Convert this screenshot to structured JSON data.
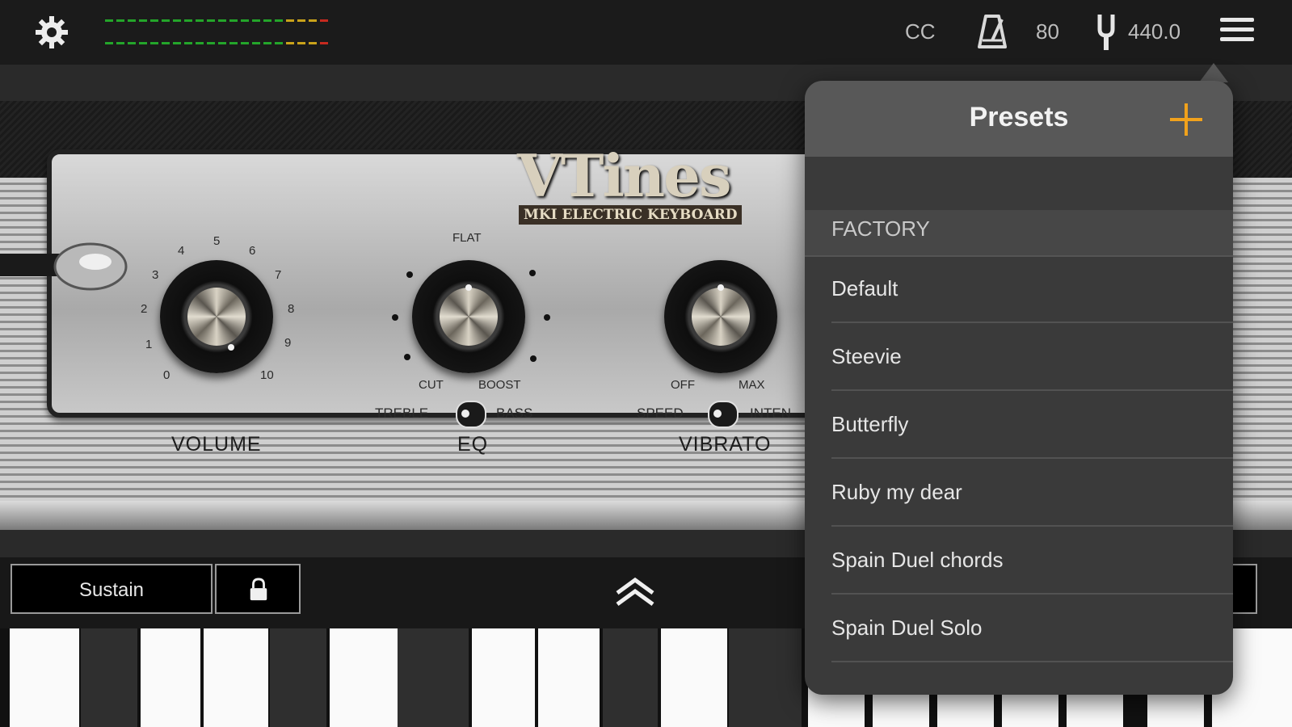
{
  "topbar": {
    "cc_label": "CC",
    "tempo_value": "80",
    "tuning_value": "440.0",
    "icons": [
      "gear-icon",
      "metronome-icon",
      "tuning-fork-icon",
      "menu-icon"
    ]
  },
  "instrument": {
    "logo_title": "VTines",
    "logo_subtitle": "MKI ELECTRIC KEYBOARD",
    "volume": {
      "label": "VOLUME",
      "scale": [
        "0",
        "1",
        "2",
        "3",
        "4",
        "5",
        "6",
        "7",
        "8",
        "9",
        "10"
      ]
    },
    "eq": {
      "label": "EQ",
      "flat": "FLAT",
      "cut": "CUT",
      "boost": "BOOST",
      "left_mode": "TREBLE",
      "right_mode": "BASS"
    },
    "vibrato": {
      "label": "VIBRATO",
      "off": "OFF",
      "max": "MAX",
      "left_mode": "SPEED",
      "right_mode": "INTEN"
    }
  },
  "controls": {
    "sustain_label": "Sustain"
  },
  "presets": {
    "title": "Presets",
    "section": "FACTORY",
    "items": [
      "Default",
      "Steevie",
      "Butterfly",
      "Ruby my dear",
      "Spain Duel chords",
      "Spain Duel Solo"
    ]
  },
  "colors": {
    "accent": "#f1a21c",
    "popover_bg": "#3a3a3a",
    "popover_header": "#585858"
  }
}
